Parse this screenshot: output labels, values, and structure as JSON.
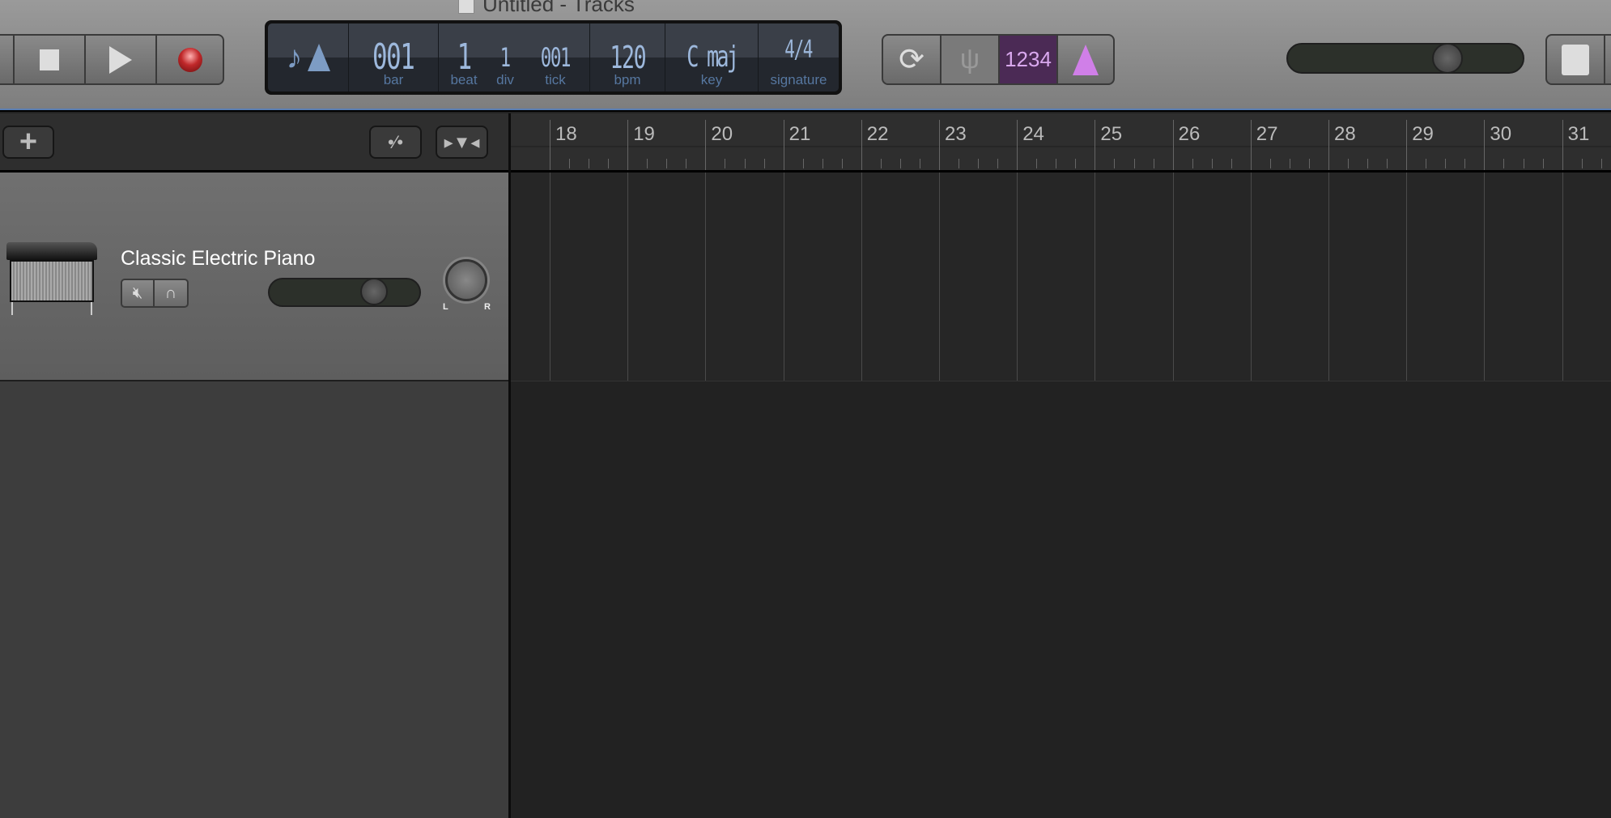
{
  "window": {
    "title": "Untitled - Tracks"
  },
  "transport": {
    "buttons": [
      "stop",
      "play",
      "record"
    ],
    "record_color": "#c0282a"
  },
  "lcd": {
    "bar": "001",
    "beat": "1",
    "div": "1",
    "tick": "001",
    "bpm": "120",
    "key": "C maj",
    "signature_num": "4",
    "signature_den": "4",
    "labels": {
      "bar": "bar",
      "beat": "beat",
      "div": "div",
      "tick": "tick",
      "bpm": "bpm",
      "key": "key",
      "signature": "signature"
    },
    "color": "#9db8dc"
  },
  "controls": {
    "count_in": "1234",
    "active_color": "#4b2a55",
    "metronome_color": "#d07fe8"
  },
  "master_volume": {
    "level": 0.68
  },
  "track": {
    "name": "Classic Electric Piano",
    "volume": 0.7,
    "pan": 0
  },
  "pan_labels": {
    "left": "L",
    "right": "R"
  },
  "ruler": {
    "bars": [
      "18",
      "19",
      "20",
      "21",
      "22",
      "23",
      "24",
      "25",
      "26",
      "27",
      "28",
      "29",
      "30",
      "31"
    ]
  }
}
